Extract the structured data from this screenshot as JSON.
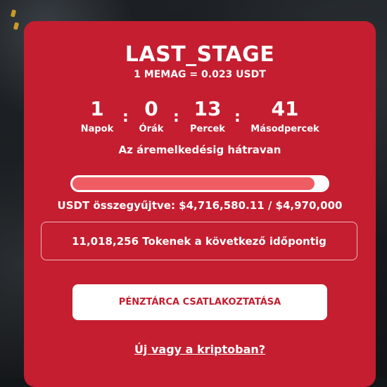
{
  "presale": {
    "stage_title": "LAST_STAGE",
    "rate": "1 MEMAG = 0.023 USDT",
    "countdown": [
      {
        "value": "1",
        "label": "Napok"
      },
      {
        "value": "0",
        "label": "Órák"
      },
      {
        "value": "13",
        "label": "Percek"
      },
      {
        "value": "41",
        "label": "Másodpercek"
      }
    ],
    "separator": ":",
    "remaining_label": "Az áremelkedésig hátravan",
    "progress_fraction": 0.949,
    "collected_text": "USDT összegyűjtve: $4,716,580.11 / $4,970,000",
    "tokens_text": "11,018,256 Tokenek a következő időpontig",
    "connect_button_label": "PÉNZTÁRCA CSATLAKOZTATÁSA",
    "crypto_link_label": "Új vagy a kriptoban?"
  },
  "colors": {
    "card": "#c41e30",
    "progress_fill": "#ef5c64",
    "text": "#ffffff"
  }
}
